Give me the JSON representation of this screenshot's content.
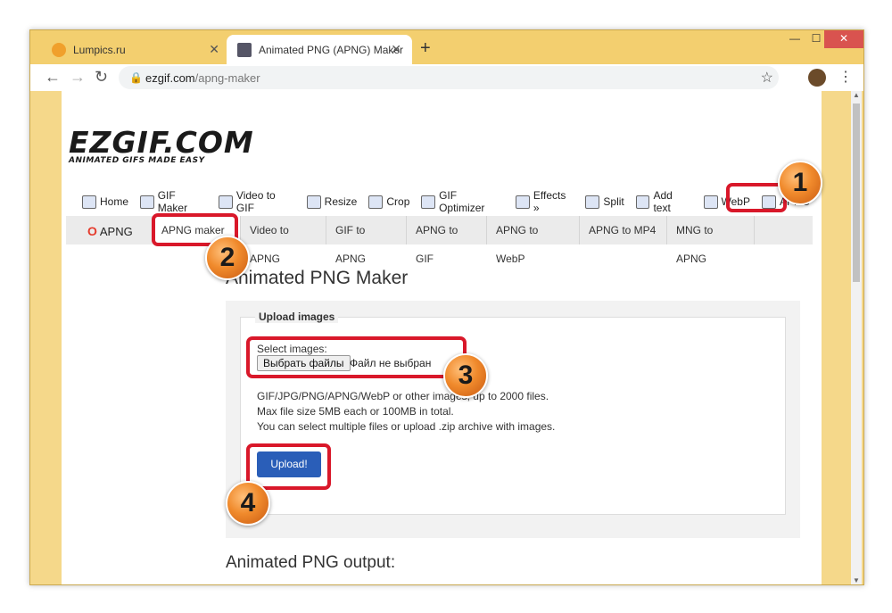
{
  "browser": {
    "tabs": [
      {
        "title": "Lumpics.ru",
        "active": false
      },
      {
        "title": "Animated PNG (APNG) Maker",
        "active": true
      }
    ],
    "url_domain": "ezgif.com",
    "url_path": "/apng-maker"
  },
  "site": {
    "logo_text": "EZGIF.COM",
    "logo_tagline": "ANIMATED GIFS MADE EASY",
    "main_nav": [
      "Home",
      "GIF Maker",
      "Video to GIF",
      "Resize",
      "Crop",
      "GIF Optimizer",
      "Effects »",
      "Split",
      "Add text",
      "WebP",
      "APNG"
    ],
    "sub_brand": "APNG",
    "sub_nav": [
      "APNG maker",
      "Video to APNG",
      "GIF to APNG",
      "APNG to GIF",
      "APNG to WebP",
      "APNG to MP4",
      "MNG to APNG"
    ]
  },
  "main": {
    "page_title": "Animated PNG Maker",
    "upload_legend": "Upload images",
    "select_label": "Select images:",
    "file_button": "Выбрать файлы",
    "file_status": "Файл не выбран",
    "info_lines": [
      "GIF/JPG/PNG/APNG/WebP or other images, up to 2000 files.",
      "Max file size 5MB each or 100MB in total.",
      "You can select multiple files or upload .zip archive with images."
    ],
    "upload_button": "Upload!",
    "output_title": "Animated PNG output:"
  },
  "annotations": [
    "1",
    "2",
    "3",
    "4"
  ],
  "colors": {
    "highlight": "#d9182a",
    "badge": "#f08a2c",
    "upload_button": "#2a5eb8"
  }
}
